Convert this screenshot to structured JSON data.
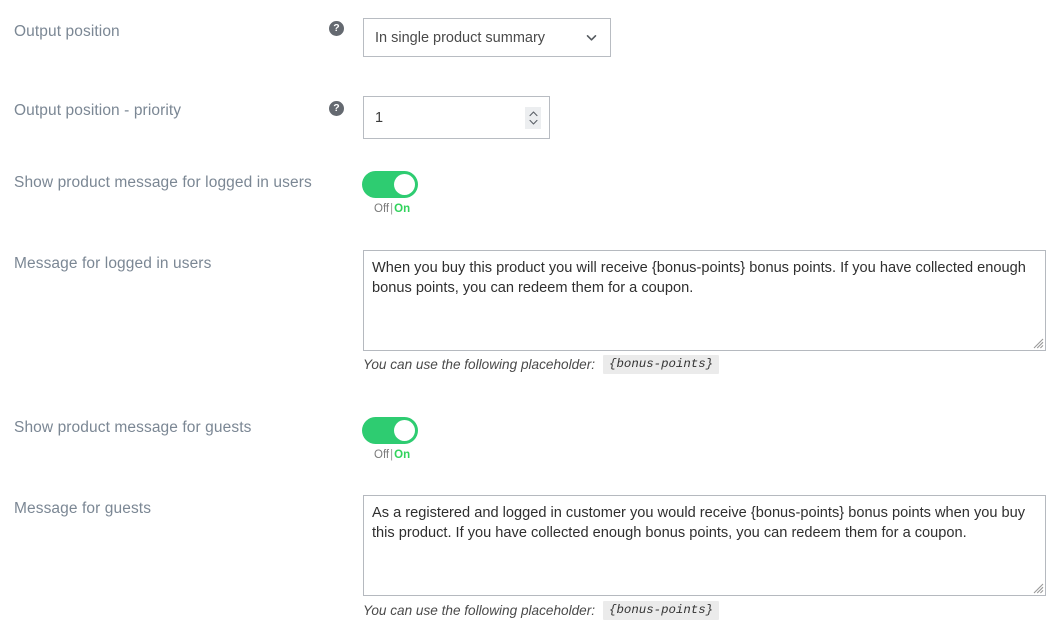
{
  "colors": {
    "label": "#7b8794",
    "toggle_on": "#2ecc71",
    "on_text": "#31d35c",
    "border": "#b8bcc2",
    "code_chip_bg": "#ebebeb",
    "help_icon_bg": "#646970"
  },
  "rows": {
    "output_position": {
      "label": "Output position",
      "help_icon": "question-mark-icon",
      "select_value": "In single product summary",
      "chevron": "chevron-down-icon"
    },
    "output_position_priority": {
      "label": "Output position - priority",
      "help_icon": "question-mark-icon",
      "value": "1",
      "spinner": "spinner-up-down-icon"
    },
    "show_message_logged_in": {
      "label": "Show product message for logged in users",
      "toggle_state": "on",
      "off_label": "Off",
      "separator": "|",
      "on_label": "On"
    },
    "message_logged_in": {
      "label": "Message for logged in users",
      "value": "When you buy this product you will receive {bonus-points} bonus points. If you have collected enough bonus points, you can redeem them for a coupon.",
      "hint_text": "You can use the following placeholder:",
      "hint_code": "{bonus-points}"
    },
    "show_message_guests": {
      "label": "Show product message for guests",
      "toggle_state": "on",
      "off_label": "Off",
      "separator": "|",
      "on_label": "On"
    },
    "message_guests": {
      "label": "Message for guests",
      "value": "As a registered and logged in customer you would receive {bonus-points} bonus points when you buy this product. If you have collected enough bonus points, you can redeem them for a coupon.",
      "hint_text": "You can use the following placeholder:",
      "hint_code": "{bonus-points}"
    }
  }
}
